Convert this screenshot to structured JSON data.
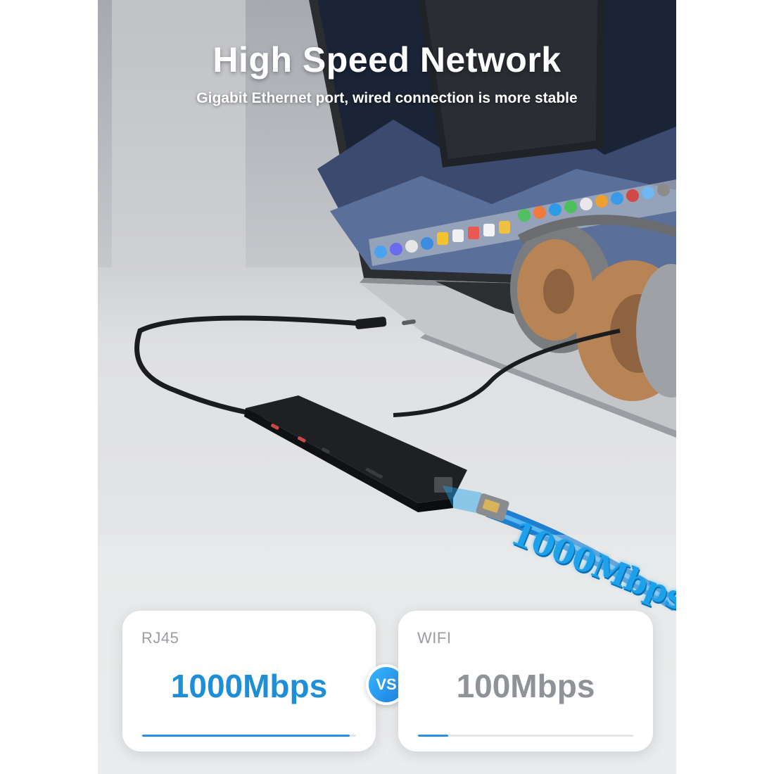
{
  "header": {
    "title": "High Speed Network",
    "subtitle": "Gigabit Ethernet port, wired connection is more stable"
  },
  "highlight": {
    "speed": "1000Mbps",
    "color": "#1da1ea"
  },
  "comparison": {
    "left": {
      "label": "RJ45",
      "value": "1000Mbps",
      "level": 0.97,
      "color": "#1e8fd6"
    },
    "divider": "VS",
    "right": {
      "label": "WIFI",
      "value": "100Mbps",
      "level": 0.14,
      "color": "#8f9296"
    }
  },
  "scene": {
    "objects": [
      "laptop-icon",
      "headphones-icon",
      "usb-c-hub-icon",
      "ethernet-cable-icon"
    ]
  }
}
